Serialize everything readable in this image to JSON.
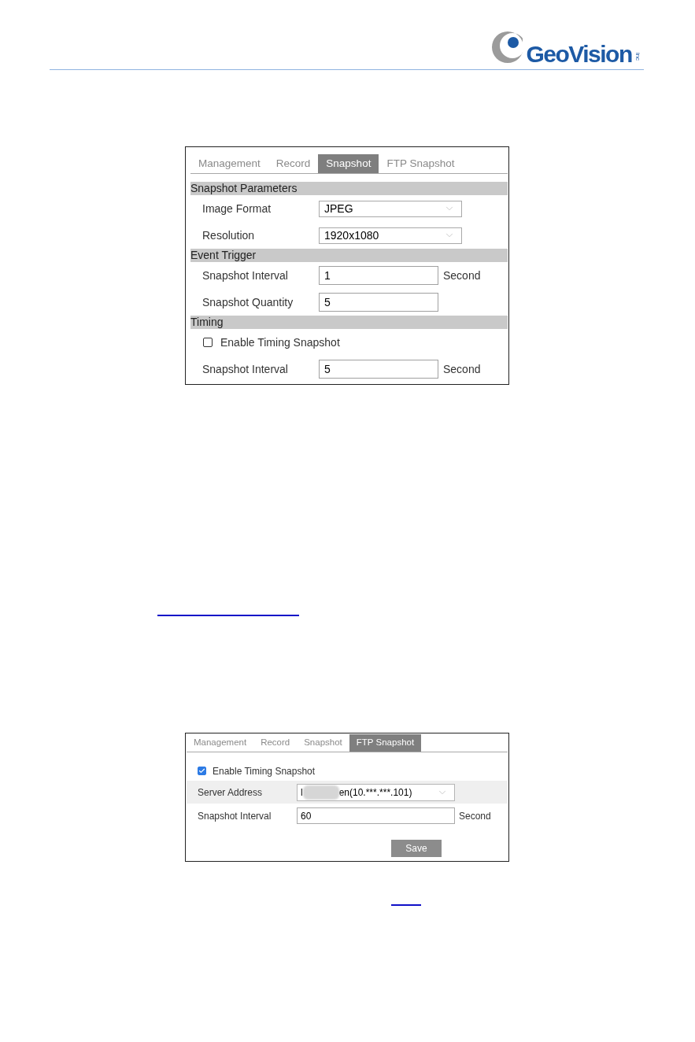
{
  "header": {
    "logo_text": "GeoVision",
    "logo_suffix": "inc"
  },
  "snapshot_panel": {
    "tabs": [
      {
        "label": "Management",
        "selected": false
      },
      {
        "label": "Record",
        "selected": false
      },
      {
        "label": "Snapshot",
        "selected": true
      },
      {
        "label": "FTP Snapshot",
        "selected": false
      }
    ],
    "rows": [
      {
        "kind": "section",
        "label": "Snapshot Parameters"
      },
      {
        "kind": "select",
        "label": "Image Format",
        "value": "JPEG"
      },
      {
        "kind": "select",
        "label": "Resolution",
        "value": "1920x1080"
      },
      {
        "kind": "section",
        "label": "Event Trigger"
      },
      {
        "kind": "input",
        "label": "Snapshot Interval",
        "value": "1",
        "unit": "Second"
      },
      {
        "kind": "input",
        "label": "Snapshot Quantity",
        "value": "5"
      },
      {
        "kind": "section",
        "label": "Timing"
      },
      {
        "kind": "checkbox",
        "label": "Enable Timing Snapshot",
        "checked": false
      },
      {
        "kind": "input",
        "label": "Snapshot Interval",
        "value": "5",
        "unit": "Second"
      }
    ]
  },
  "ftp_snapshot_panel": {
    "tabs": [
      {
        "label": "Management",
        "selected": false
      },
      {
        "label": "Record",
        "selected": false
      },
      {
        "label": "Snapshot",
        "selected": false
      },
      {
        "label": "FTP Snapshot",
        "selected": true
      }
    ],
    "rows": [
      {
        "kind": "checkbox",
        "label": "Enable Timing Snapshot",
        "checked": true,
        "highlighted": false
      },
      {
        "kind": "select",
        "label": "Server Address",
        "value_start": "l",
        "value_end": "en(10.***.***.101)",
        "redacted": true,
        "highlighted": true
      },
      {
        "kind": "input",
        "label": "Snapshot Interval",
        "value": "60",
        "unit": "Second",
        "highlighted": false
      }
    ],
    "save_button": {
      "label": "Save"
    }
  }
}
